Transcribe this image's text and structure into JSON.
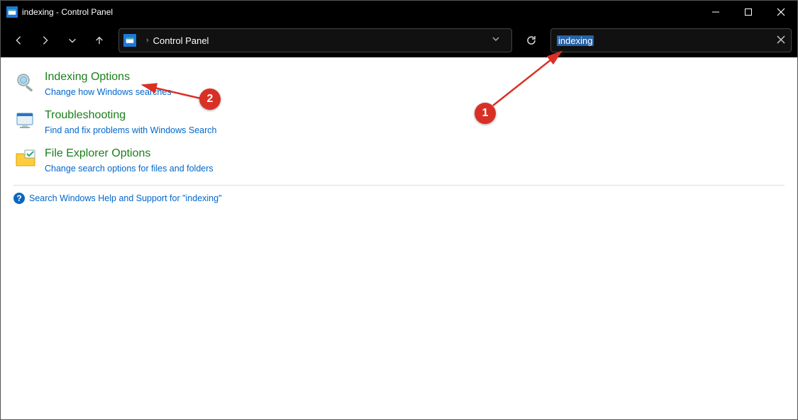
{
  "window": {
    "title": "indexing - Control Panel"
  },
  "address": {
    "crumb1": "Control Panel",
    "sep": "›"
  },
  "search": {
    "value": "indexing"
  },
  "results": [
    {
      "title": "Indexing Options",
      "sub": "Change how Windows searches"
    },
    {
      "title": "Troubleshooting",
      "sub": "Find and fix problems with Windows Search"
    },
    {
      "title": "File Explorer Options",
      "sub": "Change search options for files and folders"
    }
  ],
  "help": {
    "text": "Search Windows Help and Support for \"indexing\""
  },
  "annotations": {
    "badge1": "1",
    "badge2": "2"
  }
}
